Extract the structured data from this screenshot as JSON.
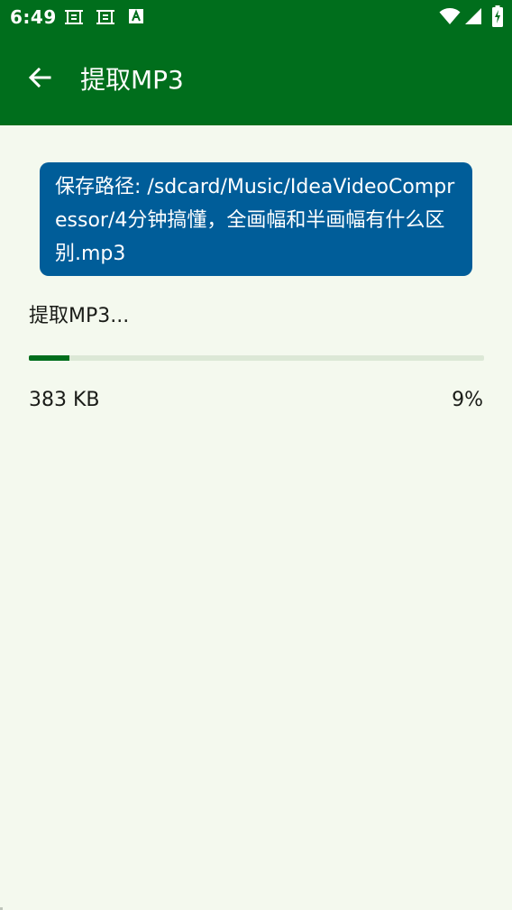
{
  "status_bar": {
    "time": "6:49",
    "notification_icons": [
      "screenshot-icon",
      "screenshot-icon",
      "font-a-icon"
    ],
    "system_icons": [
      "wifi-icon",
      "signal-icon",
      "battery-charging-icon"
    ]
  },
  "app_bar": {
    "back_icon": "arrow-back-icon",
    "title": "提取MP3"
  },
  "path_card": {
    "text": "保存路径: /sdcard/Music/IdeaVideoCompressor/4分钟搞懂，全画幅和半画幅有什么区别.mp3"
  },
  "progress": {
    "label": "提取MP3...",
    "size": "383 KB",
    "percent": "9%",
    "fraction": 0.09
  },
  "colors": {
    "primary": "#006e1c",
    "card": "#005d99",
    "background": "#f4f9ee",
    "track": "#dce8d6"
  }
}
